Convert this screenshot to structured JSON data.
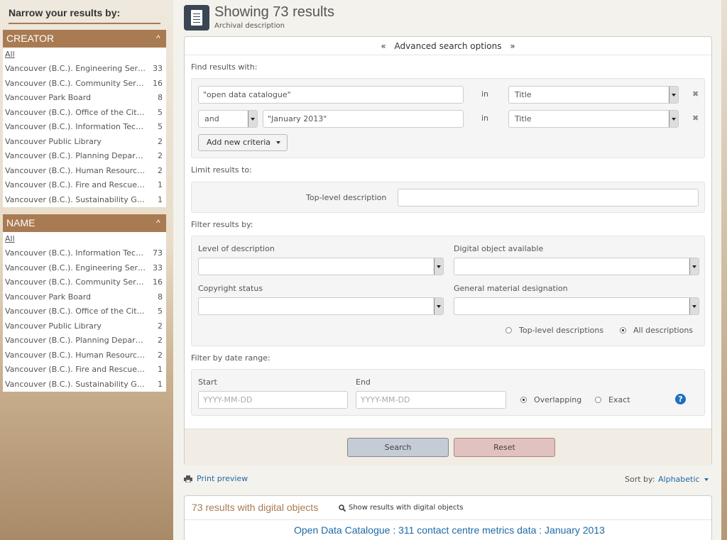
{
  "sidebar": {
    "title": "Narrow your results by:",
    "facets": [
      {
        "heading": "CREATOR",
        "all_label": "All",
        "items": [
          {
            "label": "Vancouver (B.C.). Engineering Services",
            "count": "33"
          },
          {
            "label": "Vancouver (B.C.). Community Services",
            "count": "16"
          },
          {
            "label": "Vancouver Park Board",
            "count": "8"
          },
          {
            "label": "Vancouver (B.C.). Office of the City Clerk",
            "count": "5"
          },
          {
            "label": "Vancouver (B.C.). Information Technology",
            "count": "5"
          },
          {
            "label": "Vancouver Public Library",
            "count": "2"
          },
          {
            "label": "Vancouver (B.C.). Planning Department",
            "count": "2"
          },
          {
            "label": "Vancouver (B.C.). Human Resources",
            "count": "2"
          },
          {
            "label": "Vancouver (B.C.). Fire and Rescue Services",
            "count": "1"
          },
          {
            "label": "Vancouver (B.C.). Sustainability Group",
            "count": "1"
          }
        ]
      },
      {
        "heading": "NAME",
        "all_label": "All",
        "items": [
          {
            "label": "Vancouver (B.C.). Information Technology",
            "count": "73"
          },
          {
            "label": "Vancouver (B.C.). Engineering Services",
            "count": "33"
          },
          {
            "label": "Vancouver (B.C.). Community Services",
            "count": "16"
          },
          {
            "label": "Vancouver Park Board",
            "count": "8"
          },
          {
            "label": "Vancouver (B.C.). Office of the City Clerk",
            "count": "5"
          },
          {
            "label": "Vancouver Public Library",
            "count": "2"
          },
          {
            "label": "Vancouver (B.C.). Planning Department",
            "count": "2"
          },
          {
            "label": "Vancouver (B.C.). Human Resources",
            "count": "2"
          },
          {
            "label": "Vancouver (B.C.). Fire and Rescue Services",
            "count": "1"
          },
          {
            "label": "Vancouver (B.C.). Sustainability Group",
            "count": "1"
          }
        ]
      }
    ]
  },
  "header": {
    "title": "Showing 73 results",
    "subtitle": "Archival description"
  },
  "search": {
    "advanced_toggle": "Advanced search options",
    "find_label": "Find results with:",
    "criteria": [
      {
        "operator": "",
        "query": "\"open data catalogue\"",
        "in_label": "in",
        "field": "Title"
      },
      {
        "operator": "and",
        "query": "\"January 2013\"",
        "in_label": "in",
        "field": "Title"
      }
    ],
    "add_criteria": "Add new criteria",
    "limit_label": "Limit results to:",
    "top_level_label": "Top-level description",
    "top_level_value": "",
    "filter_label": "Filter results by:",
    "level_label": "Level of description",
    "digital_label": "Digital object available",
    "copyright_label": "Copyright status",
    "gmd_label": "General material designation",
    "radio_top": "Top-level descriptions",
    "radio_all": "All descriptions",
    "date_label": "Filter by date range:",
    "start_label": "Start",
    "end_label": "End",
    "start_placeholder": "YYYY-MM-DD",
    "end_placeholder": "YYYY-MM-DD",
    "overlapping_label": "Overlapping",
    "exact_label": "Exact",
    "help": "?",
    "search_button": "Search",
    "reset_button": "Reset"
  },
  "results": {
    "print_preview": "Print preview",
    "sort_label": "Sort by:",
    "sort_value": "Alphabetic",
    "digital_count": "73 results with digital objects",
    "show_digital": "Show results with digital objects",
    "first_result_title": "Open Data Catalogue : 311 contact centre metrics data : January 2013"
  },
  "colors": {
    "accent_brown": "#a97b52",
    "link_blue": "#1e6aa6",
    "search_button": "#c5ccd6",
    "reset_button": "#e2c2c0"
  }
}
